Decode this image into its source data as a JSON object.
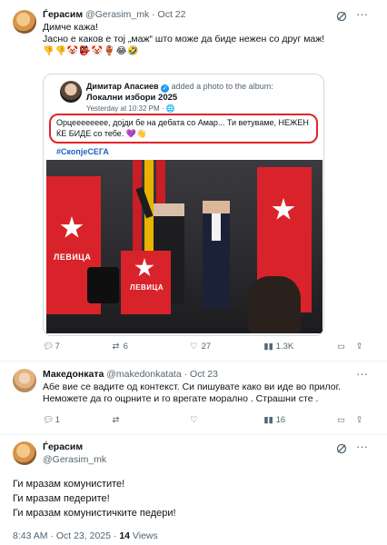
{
  "tweet1": {
    "author_name": "Ѓерасим",
    "author_handle": "@Gerasim_mk",
    "date": "· Oct 22",
    "line1": "Димче кажа!",
    "line2": "Јасно е каков е тој „маж“ што може да биде нежен со друг маж!",
    "emojis": "👎👎🤡👺🤡🏺😂🤣",
    "embed": {
      "author": "Димитар Апасиев",
      "action": "added a photo to the album:",
      "album": "Локални избори 2025",
      "time": "Yesterday at 10:32 PM · ",
      "quote_line1": "Орцееееееее, дојди бе на дебата со Амар... Ти ветуваме, НЕЖЕН",
      "quote_line2": "ЌЕ БИДЕ со тебе. 💜👋",
      "hashtag": "#СкопјеСЕГА",
      "banner_text": "ЛЕВИЦА"
    },
    "stats": {
      "replies": "7",
      "retweets": "6",
      "likes": "27",
      "views": "1.3K"
    }
  },
  "tweet2": {
    "author_name": "Македонката",
    "author_handle": "@makedonkatata",
    "date": "· Oct 23",
    "line1": "Абе вие се вадите од контекст. Си пишувате како ви иде во прилог.",
    "line2": "Неможете да го оцрните и го врегате морално . Страшни сте .",
    "stats": {
      "replies": "1",
      "retweets": "",
      "likes": "",
      "views": "16"
    }
  },
  "tweet3": {
    "author_name": "Ѓерасим",
    "author_handle": "@Gerasim_mk",
    "line1": "Ги мразам комунистите!",
    "line2": "Ги мразам педерите!",
    "line3": "Ги мразам комунистичките педери!",
    "timestamp": "8:43 AM · Oct 23, 2025 · ",
    "views_count": "14",
    "views_label": " Views"
  },
  "colors": {
    "accent_red": "#e0242b",
    "link_blue": "#1d62c4",
    "muted": "#536471",
    "verified": "#1d9bf0"
  },
  "icons": [
    "grok-icon",
    "more-icon",
    "reply-icon",
    "retweet-icon",
    "like-icon",
    "views-icon",
    "bookmark-icon",
    "share-icon",
    "verified-icon"
  ]
}
